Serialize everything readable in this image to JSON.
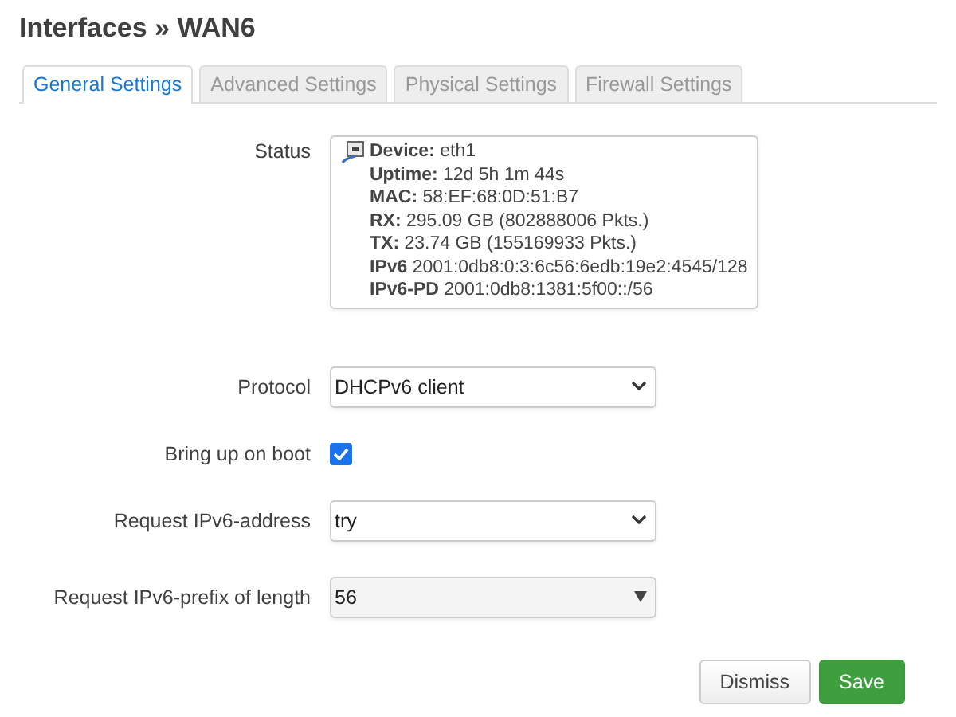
{
  "title": "Interfaces » WAN6",
  "tabs": [
    {
      "label": "General Settings",
      "selected": true
    },
    {
      "label": "Advanced Settings",
      "selected": false
    },
    {
      "label": "Physical Settings",
      "selected": false
    },
    {
      "label": "Firewall Settings",
      "selected": false
    }
  ],
  "status": {
    "label": "Status",
    "lines": [
      "**Device:** eth1",
      "**Uptime:** 12d 5h 1m 44s",
      "**MAC:** 58:EF:68:0D:51:B7",
      "**RX:** 295.09 GB (802888006 Pkts.)",
      "**TX:** 23.74 GB (155169933 Pkts.)",
      "**IPv6** 2001:0db8:0:3:6c56:6edb:19e2:4545/128",
      "**IPv6-PD** 2001:0db8:1381:5f00::/56"
    ]
  },
  "fields": [
    {
      "kind": "select",
      "label": "Protocol",
      "value": "DHCPv6 client"
    },
    {
      "kind": "checkbox",
      "label": "Bring up on boot",
      "checked": true
    },
    {
      "kind": "select",
      "label": "Request IPv6-address",
      "value": "try"
    },
    {
      "kind": "combo",
      "label": "Request IPv6-prefix of length",
      "value": "56"
    }
  ],
  "buttons": [
    {
      "label": "Dismiss",
      "kind": "neutral"
    },
    {
      "label": "Save",
      "kind": "primary"
    }
  ]
}
